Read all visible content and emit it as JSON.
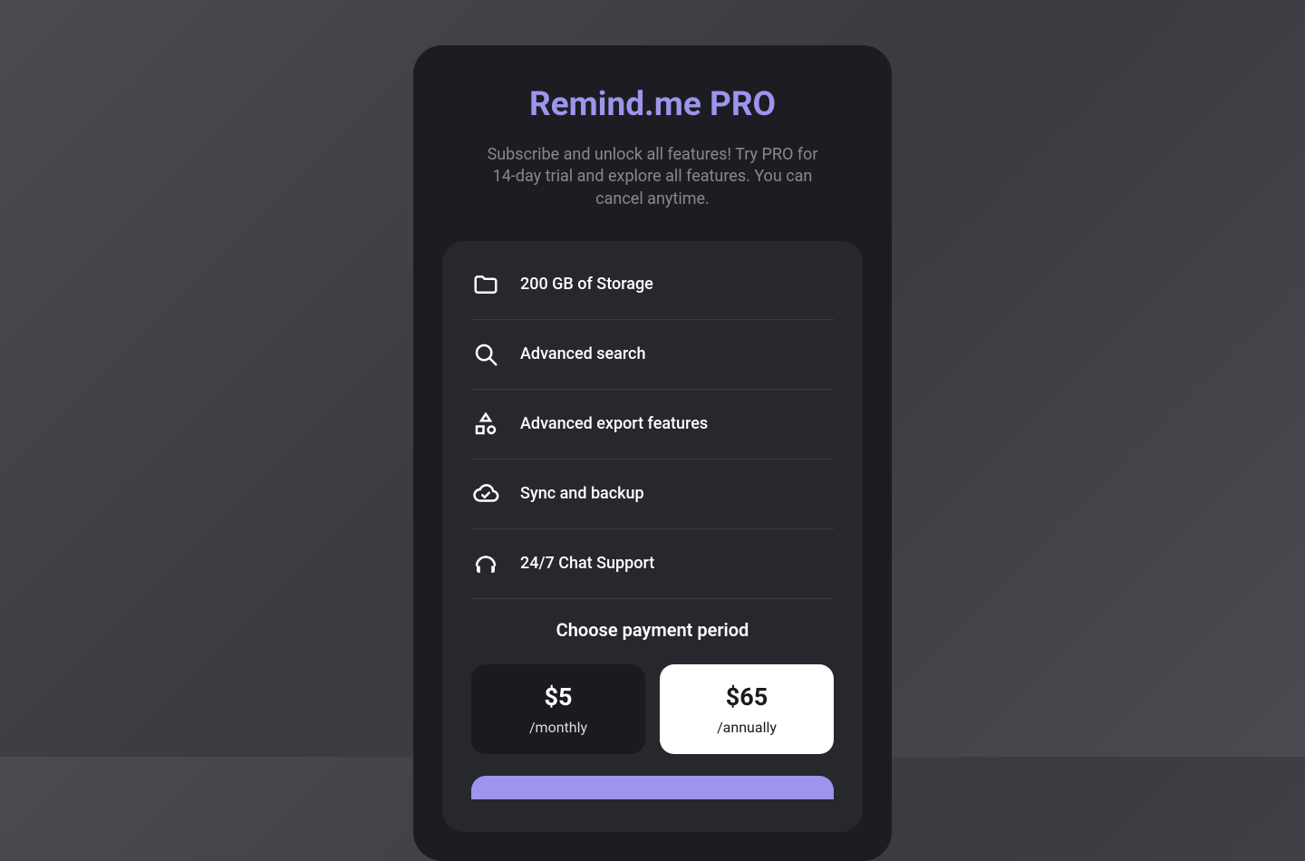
{
  "title": "Remind.me PRO",
  "subtitle": "Subscribe and unlock all features! Try PRO for 14-day trial and explore all features. You can cancel anytime.",
  "features": [
    {
      "label": "200 GB of Storage",
      "icon": "folder-icon"
    },
    {
      "label": "Advanced search",
      "icon": "search-icon"
    },
    {
      "label": "Advanced export features",
      "icon": "shapes-icon"
    },
    {
      "label": "Sync and backup",
      "icon": "cloud-check-icon"
    },
    {
      "label": "24/7 Chat Support",
      "icon": "support-icon"
    }
  ],
  "payment": {
    "title": "Choose payment period",
    "options": [
      {
        "price": "$5",
        "period": "/monthly",
        "selected": false
      },
      {
        "price": "$65",
        "period": "/annually",
        "selected": true
      }
    ]
  },
  "colors": {
    "accent": "#9d94ed",
    "modal_bg": "#1c1c22",
    "card_bg": "#27272e"
  }
}
